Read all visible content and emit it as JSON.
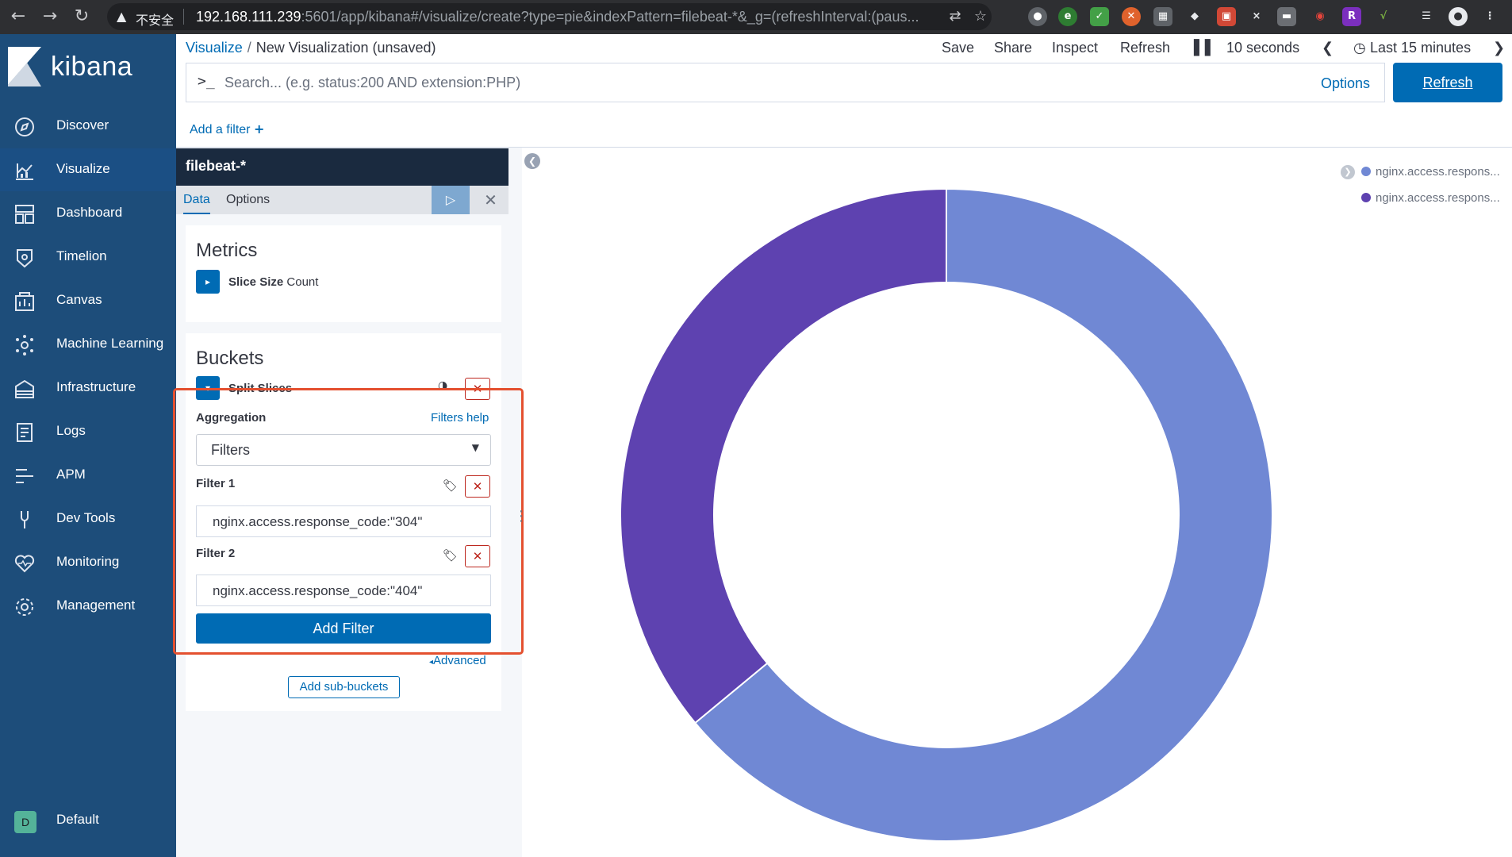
{
  "browser": {
    "security_label": "不安全",
    "url_host": "192.168.111.239",
    "url_rest": ":5601/app/kibana#/visualize/create?type=pie&indexPattern=filebeat-*&_g=(refreshInterval:(paus..."
  },
  "sidebar": {
    "brand": "kibana",
    "items": [
      {
        "label": "Discover",
        "icon": "compass-icon"
      },
      {
        "label": "Visualize",
        "icon": "visualize-icon"
      },
      {
        "label": "Dashboard",
        "icon": "dashboard-icon"
      },
      {
        "label": "Timelion",
        "icon": "timelion-icon"
      },
      {
        "label": "Canvas",
        "icon": "canvas-icon"
      },
      {
        "label": "Machine Learning",
        "icon": "ml-icon"
      },
      {
        "label": "Infrastructure",
        "icon": "infrastructure-icon"
      },
      {
        "label": "Logs",
        "icon": "logs-icon"
      },
      {
        "label": "APM",
        "icon": "apm-icon"
      },
      {
        "label": "Dev Tools",
        "icon": "devtools-icon"
      },
      {
        "label": "Monitoring",
        "icon": "monitoring-icon"
      },
      {
        "label": "Management",
        "icon": "gear-icon"
      }
    ],
    "space": {
      "initial": "D",
      "label": "Default"
    }
  },
  "header": {
    "breadcrumb_link": "Visualize",
    "breadcrumb_sep": "/",
    "breadcrumb_current": "New Visualization (unsaved)",
    "menu": {
      "save": "Save",
      "share": "Share",
      "inspect": "Inspect",
      "refresh": "Refresh",
      "interval": "10 seconds",
      "time_range": "Last 15 minutes"
    }
  },
  "query": {
    "prompt": ">_",
    "placeholder": "Search... (e.g. status:200 AND extension:PHP)",
    "options": "Options",
    "refresh_button": "Refresh"
  },
  "filters": {
    "add_filter": "Add a filter"
  },
  "editor": {
    "index_pattern": "filebeat-*",
    "tabs": {
      "data": "Data",
      "options": "Options"
    },
    "metrics": {
      "title": "Metrics",
      "agg_name": "Slice Size",
      "agg_type": "Count"
    },
    "buckets": {
      "title": "Buckets",
      "agg_name": "Split Slices",
      "aggregation_label": "Aggregation",
      "help_link": "Filters help",
      "selected_aggregation": "Filters",
      "filter1_label": "Filter 1",
      "filter1_value": "nginx.access.response_code:\"304\"",
      "filter2_label": "Filter 2",
      "filter2_value": "nginx.access.response_code:\"404\"",
      "add_filter_button": "Add Filter",
      "advanced_link": "Advanced",
      "add_sub_buckets": "Add sub-buckets"
    }
  },
  "chart_data": {
    "type": "pie",
    "donut": true,
    "categories": [
      "nginx.access.respons...",
      "nginx.access.respons..."
    ],
    "values": [
      64,
      36
    ],
    "colors": [
      "#7088d4",
      "#5e42b0"
    ],
    "legend_position": "top-right"
  }
}
